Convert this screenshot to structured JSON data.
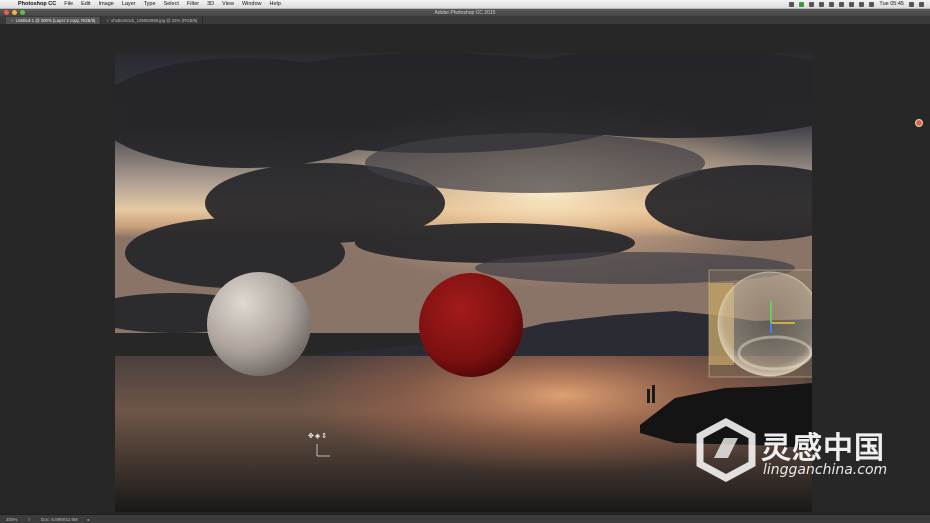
{
  "menubar": {
    "apple": "",
    "items": [
      "Photoshop CC",
      "File",
      "Edit",
      "Image",
      "Layer",
      "Type",
      "Select",
      "Filter",
      "3D",
      "View",
      "Window",
      "Help"
    ],
    "clock": "Tue 05:45"
  },
  "window": {
    "title": "Adobe Photoshop CC 2015"
  },
  "tabs": [
    {
      "label": "Untitled-1 @ 200% (Layer 2 copy, RGB/8)",
      "active": true
    },
    {
      "label": "shutterstock_139063889.jpg @ 33% (RGB/8)",
      "active": false
    }
  ],
  "statusbar": {
    "zoom": "200%",
    "doc": "Doc: 6.89M/42.9M"
  },
  "watermark": {
    "brand": "灵感中国",
    "url": "lingganchina.com"
  },
  "colors": {
    "accent": "#d46b4a",
    "red_sphere": "#8a1414",
    "white_sphere": "#c9c2bb"
  }
}
